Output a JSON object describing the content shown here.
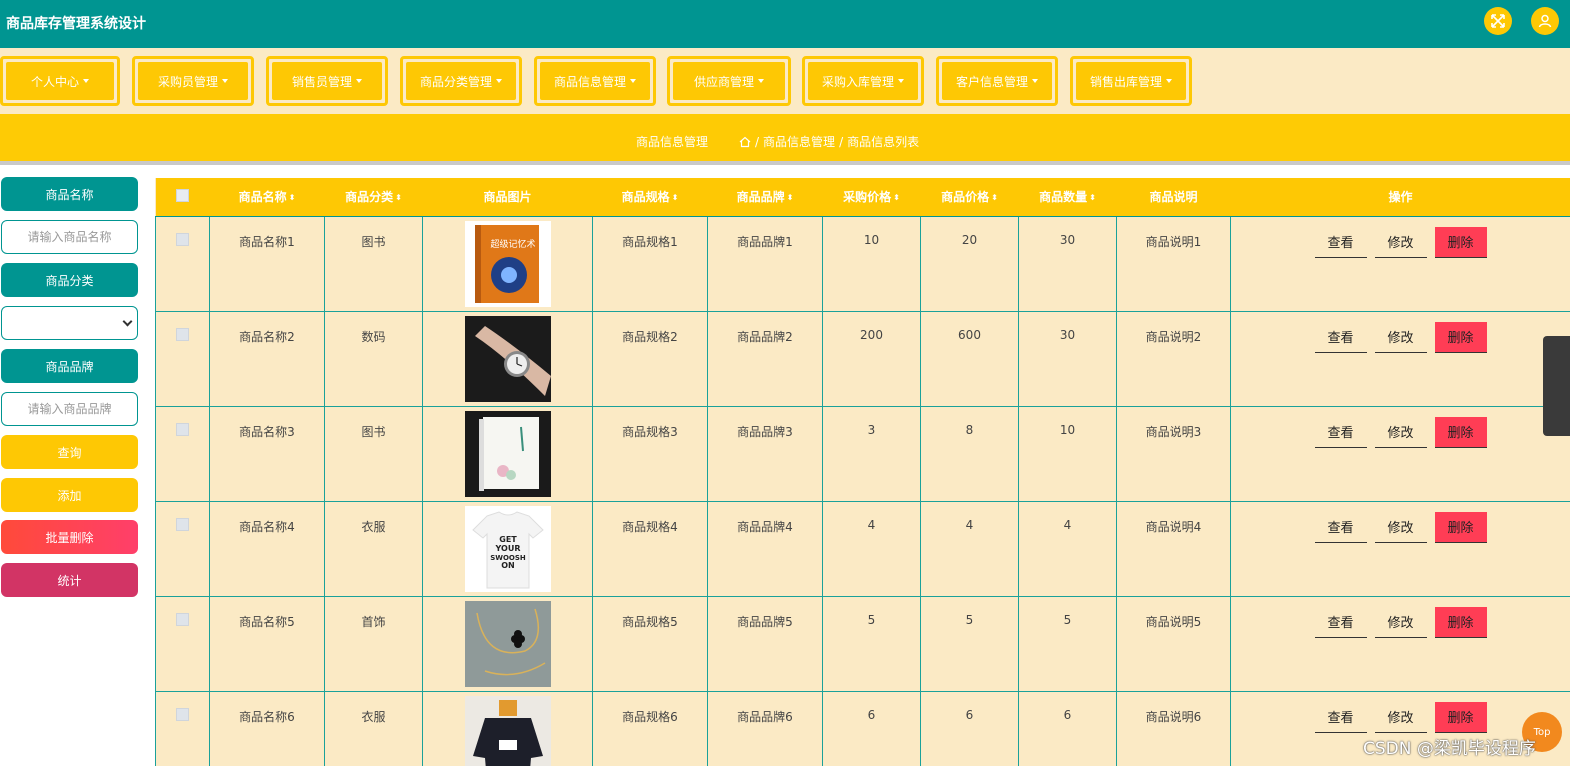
{
  "header": {
    "title": "商品库存管理系统设计"
  },
  "nav": {
    "items": [
      {
        "label": "个人中心"
      },
      {
        "label": "采购员管理"
      },
      {
        "label": "销售员管理"
      },
      {
        "label": "商品分类管理"
      },
      {
        "label": "商品信息管理"
      },
      {
        "label": "供应商管理"
      },
      {
        "label": "采购入库管理"
      },
      {
        "label": "客户信息管理"
      },
      {
        "label": "销售出库管理"
      }
    ]
  },
  "breadcrumb": {
    "section": "商品信息管理",
    "path1": "商品信息管理",
    "sep": "/",
    "path2": "商品信息列表"
  },
  "sidebar": {
    "name_label": "商品名称",
    "name_placeholder": "请输入商品名称",
    "category_label": "商品分类",
    "category_value": "",
    "brand_label": "商品品牌",
    "brand_placeholder": "请输入商品品牌",
    "query_button": "查询",
    "add_button": "添加",
    "batch_delete_button": "批量删除",
    "stats_button": "统计"
  },
  "table": {
    "headers": {
      "name": "商品名称",
      "category": "商品分类",
      "image": "商品图片",
      "spec": "商品规格",
      "brand": "商品品牌",
      "purchase_price": "采购价格",
      "price": "商品价格",
      "quantity": "商品数量",
      "desc": "商品说明",
      "actions": "操作"
    },
    "rows": [
      {
        "name": "商品名称1",
        "category": "图书",
        "image": "book-memory-cover",
        "spec": "商品规格1",
        "brand": "商品品牌1",
        "purchase_price": "10",
        "price": "20",
        "quantity": "30",
        "desc": "商品说明1"
      },
      {
        "name": "商品名称2",
        "category": "数码",
        "image": "wrist-watch",
        "spec": "商品规格2",
        "brand": "商品品牌2",
        "purchase_price": "200",
        "price": "600",
        "quantity": "30",
        "desc": "商品说明2"
      },
      {
        "name": "商品名称3",
        "category": "图书",
        "image": "book-white-cover",
        "spec": "商品规格3",
        "brand": "商品品牌3",
        "purchase_price": "3",
        "price": "8",
        "quantity": "10",
        "desc": "商品说明3"
      },
      {
        "name": "商品名称4",
        "category": "衣服",
        "image": "white-tshirt",
        "spec": "商品规格4",
        "brand": "商品品牌4",
        "purchase_price": "4",
        "price": "4",
        "quantity": "4",
        "desc": "商品说明4"
      },
      {
        "name": "商品名称5",
        "category": "首饰",
        "image": "necklace",
        "spec": "商品规格5",
        "brand": "商品品牌5",
        "purchase_price": "5",
        "price": "5",
        "quantity": "5",
        "desc": "商品说明5"
      },
      {
        "name": "商品名称6",
        "category": "衣服",
        "image": "black-hoodie",
        "spec": "商品规格6",
        "brand": "商品品牌6",
        "purchase_price": "6",
        "price": "6",
        "quantity": "6",
        "desc": "商品说明6"
      }
    ],
    "actions": {
      "view": "查看",
      "edit": "修改",
      "delete": "删除"
    }
  },
  "tshirt_text": "GET YOUR SWOOSH ON",
  "book_title": "超级记忆术",
  "top_button": "Top",
  "watermark": "CSDN @梁凯毕设程序",
  "colors": {
    "teal": "#009591",
    "yellow": "#fec804",
    "cream": "#fbeac5",
    "delete": "#ff3d55"
  }
}
